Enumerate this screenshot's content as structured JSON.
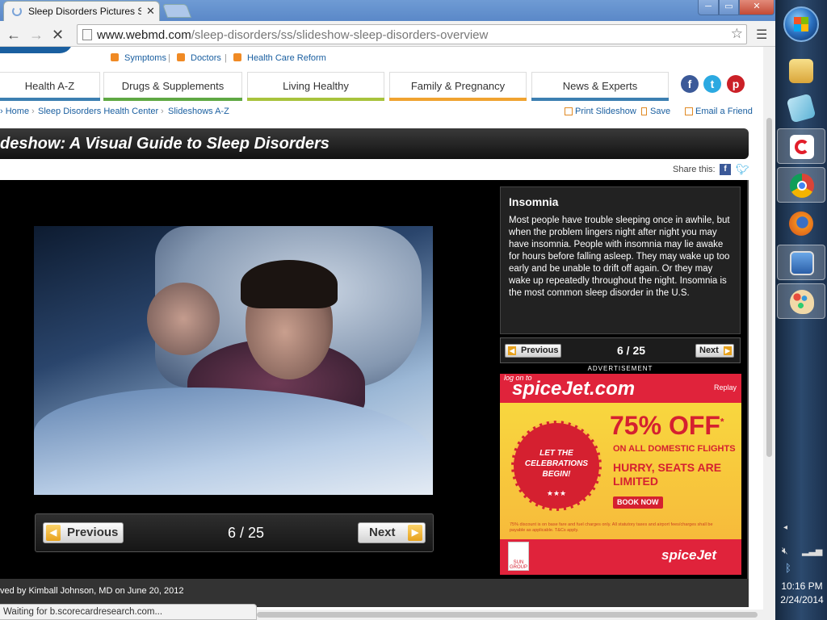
{
  "browser": {
    "tab_title": "Sleep Disorders Pictures Sl",
    "tab_close": "✕",
    "url_host": "www.webmd.com",
    "url_path": "/sleep-disorders/ss/slideshow-sleep-disorders-overview",
    "back_icon": "back-arrow-icon",
    "forward_icon": "forward-arrow-icon",
    "stop_icon": "stop-x-icon",
    "star_icon": "bookmark-star-icon",
    "menu_icon": "hamburger-menu-icon",
    "window_buttons": {
      "minimize": "─",
      "maximize": "▭",
      "close": "✕"
    },
    "status_text": "Waiting for b.scorecardresearch.com..."
  },
  "top_links": [
    "Symptoms",
    "Doctors",
    "Health Care Reform"
  ],
  "nav_tabs": [
    {
      "label": "Health A-Z",
      "color": "#3c7fb1"
    },
    {
      "label": "Drugs & Supplements",
      "color": "#5fa843"
    },
    {
      "label": "Living Healthy",
      "color": "#a8c33c"
    },
    {
      "label": "Family & Pregnancy",
      "color": "#f0a330"
    },
    {
      "label": "News & Experts",
      "color": "#3c7fb1"
    }
  ],
  "social": {
    "facebook": "f",
    "twitter": "t",
    "pinterest": "p"
  },
  "breadcrumb": [
    "Home",
    "Sleep Disorders Health Center",
    "Slideshows A-Z"
  ],
  "actions": {
    "print": "Print Slideshow",
    "save": "Save",
    "email": "Email a Friend"
  },
  "slideshow": {
    "title": "deshow: A Visual Guide to Sleep Disorders",
    "share_label": "Share this:",
    "slide_heading": "Insomnia",
    "slide_text": "Most people have trouble sleeping once in awhile, but when the problem lingers night after night you may have insomnia. People with insomnia may lie awake for hours before falling asleep. They may wake up too early and be unable to drift off again. Or they may wake up repeatedly throughout the night. Insomnia is the most common sleep disorder in the U.S.",
    "previous": "Previous",
    "next": "Next",
    "counter": "6 / 25",
    "byline": "ved by Kimball Johnson, MD on June 20, 2012"
  },
  "ad": {
    "label": "ADVERTISEMENT",
    "log_on": "log on to",
    "brand": "spiceJet.com",
    "replay": "Replay",
    "seal_text": "LET THE CELEBRATIONS BEGIN!",
    "stars": "★★★",
    "offer": "75% OFF",
    "offer_star": "*",
    "scope": "ON ALL DOMESTIC FLIGHTS",
    "hurry": "HURRY, SEATS ARE LIMITED",
    "book": "BOOK NOW",
    "fine_print": "75% discount is on base fare and fuel charges only. All statutory taxes and airport fees/charges shall be payable as applicable. T&Cs apply.",
    "sun_group": "SUN GROUP",
    "brand_footer": "spiceJet"
  },
  "taskbar": {
    "time": "10:16 PM",
    "date": "2/24/2014",
    "tray_arrow": "◂"
  }
}
